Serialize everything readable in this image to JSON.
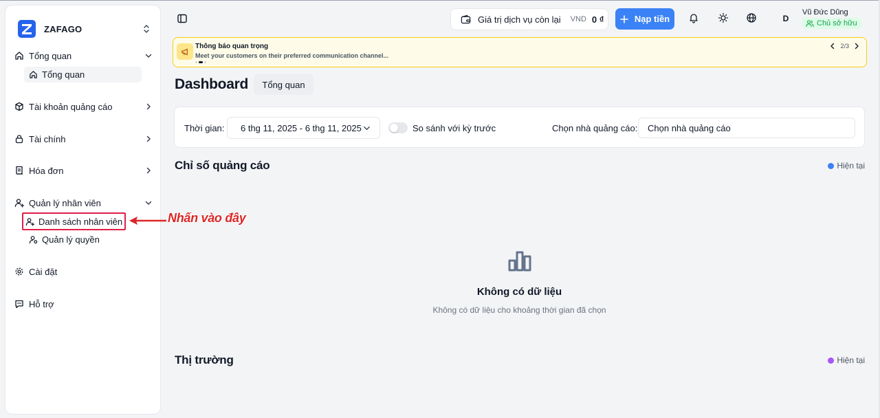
{
  "brand": {
    "name": "ZAFAGO"
  },
  "sidebar": {
    "groups": [
      {
        "label": "Tổng quan",
        "sub": [
          {
            "label": "Tổng quan"
          }
        ]
      },
      {
        "label": "Tài khoản quảng cáo"
      },
      {
        "label": "Tài chính"
      },
      {
        "label": "Hóa đơn"
      },
      {
        "label": "Quản lý nhân viên",
        "sub": [
          {
            "label": "Danh sách nhân viên"
          },
          {
            "label": "Quản lý quyền"
          }
        ]
      },
      {
        "label": "Cài đặt"
      },
      {
        "label": "Hỗ trợ"
      }
    ]
  },
  "annotation": {
    "text": "Nhấn vào đây"
  },
  "header": {
    "balance_label": "Giá trị dịch vụ còn lại",
    "currency": "VND",
    "amount": "0 ₫",
    "topup_label": "Nạp tiền",
    "user_initial": "D",
    "user_name": "Vũ Đức Dũng",
    "user_role": "Chủ sở hữu"
  },
  "notice": {
    "title": "Thông báo quan trọng",
    "message": "Meet your customers on their preferred communication channel...",
    "pager": "2/3"
  },
  "main": {
    "title": "Dashboard",
    "tab": "Tổng quan",
    "filters": {
      "time_label": "Thời gian:",
      "date_range": "6 thg 11, 2025 - 6 thg 11, 2025",
      "compare_label": "So sánh với kỳ trước",
      "advertiser_label": "Chọn nhà quảng cáo:",
      "advertiser_value": "Chọn nhà quảng cáo"
    },
    "ad_metrics": {
      "title": "Chỉ số quảng cáo",
      "legend": "Hiện tại",
      "empty_title": "Không có dữ liệu",
      "empty_desc": "Không có dữ liệu cho khoảng thời gian đã chọn"
    },
    "market": {
      "title": "Thị trường",
      "legend": "Hiện tại"
    }
  },
  "colors": {
    "primary": "#3b82f6",
    "legend_blue": "#3b82f6",
    "legend_purple": "#a855f7",
    "annotation_red": "#dc2626",
    "role_green": "#16a34a"
  }
}
